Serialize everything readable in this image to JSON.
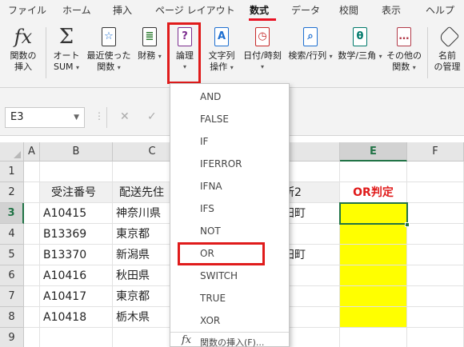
{
  "ribbon_tabs": [
    {
      "label": "ファイル",
      "active": false
    },
    {
      "label": "ホーム",
      "active": false
    },
    {
      "label": "挿入",
      "active": false
    },
    {
      "label": "ページ レイアウト",
      "active": false
    },
    {
      "label": "数式",
      "active": true
    },
    {
      "label": "データ",
      "active": false
    },
    {
      "label": "校閲",
      "active": false
    },
    {
      "label": "表示",
      "active": false
    },
    {
      "label": "ヘルプ",
      "active": false
    }
  ],
  "ribbon": {
    "insert_function": {
      "line1": "関数の",
      "line2": "挿入",
      "icon": "fx-icon"
    },
    "autosum": {
      "line1": "オート",
      "line2": "SUM",
      "icon": "sigma-icon"
    },
    "recent": {
      "line1": "最近使った",
      "line2": "関数",
      "icon": "star-book-icon"
    },
    "financial": {
      "line1": "財務",
      "icon": "database-book-icon"
    },
    "logical": {
      "line1": "論理",
      "icon": "question-book-icon"
    },
    "text": {
      "line1": "文字列",
      "line2": "操作",
      "icon": "a-book-icon"
    },
    "datetime": {
      "line1": "日付/時刻",
      "icon": "clock-book-icon"
    },
    "lookup": {
      "line1": "検索/行列",
      "icon": "magnifier-book-icon"
    },
    "math": {
      "line1": "数学/三角",
      "icon": "theta-book-icon"
    },
    "more": {
      "line1": "その他の",
      "line2": "関数",
      "icon": "ellipsis-book-icon"
    },
    "name_manager": {
      "line1": "名前",
      "line2": "の管理",
      "icon": "tag-icon"
    }
  },
  "formula_bar": {
    "name_box": "E3",
    "cancel_glyph": "✕",
    "enter_glyph": "✓"
  },
  "columns": [
    "A",
    "B",
    "C",
    "D",
    "E",
    "F"
  ],
  "rows": [
    "1",
    "2",
    "3",
    "4",
    "5",
    "6",
    "7",
    "8",
    "9"
  ],
  "selected_cell": "E3",
  "header_row": {
    "b": "受注番号",
    "c": "配送先住",
    "d": "所2",
    "e": "OR判定"
  },
  "data_rows": [
    {
      "b": "A10415",
      "c": "神奈川県",
      "d": "田町"
    },
    {
      "b": "B13369",
      "c": "東京都",
      "d": ""
    },
    {
      "b": "B13370",
      "c": "新潟県",
      "d": "田町"
    },
    {
      "b": "A10416",
      "c": "秋田県",
      "d": ""
    },
    {
      "b": "A10417",
      "c": "東京都",
      "d": ""
    },
    {
      "b": "A10418",
      "c": "栃木県",
      "d": ""
    }
  ],
  "highlight_color": "#ffff00",
  "accent_red": "#e01b1b",
  "excel_green": "#217346",
  "logical_menu": {
    "items": [
      "AND",
      "FALSE",
      "IF",
      "IFERROR",
      "IFNA",
      "IFS",
      "NOT",
      "OR",
      "SWITCH",
      "TRUE",
      "XOR"
    ],
    "highlighted_item": "OR",
    "insert_function_label": "関数の挿入(F)..."
  }
}
